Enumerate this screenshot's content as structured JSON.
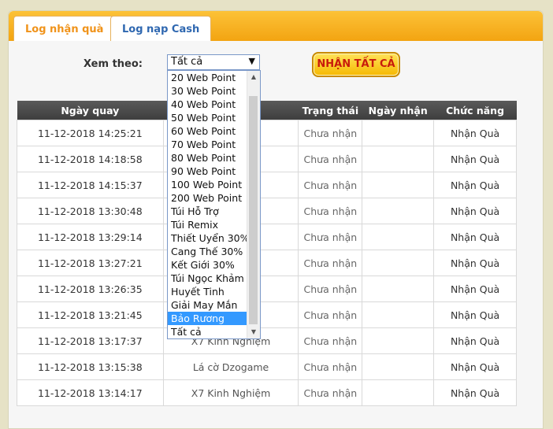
{
  "tabs": [
    {
      "label": "Log nhận quà",
      "active": true
    },
    {
      "label": "Log nạp Cash",
      "active": false
    }
  ],
  "filter": {
    "label": "Xem theo:",
    "selected_value": "Tất cả",
    "options": [
      "20 Web Point",
      "30 Web Point",
      "40 Web Point",
      "50 Web Point",
      "60 Web Point",
      "70 Web Point",
      "80 Web Point",
      "90 Web Point",
      "100 Web Point",
      "200 Web Point",
      "Túi Hỗ Trợ",
      "Túi Remix",
      "Thiết Uyển 30%",
      "Cang Thế 30%",
      "Kết Giới 30%",
      "Túi Ngọc Khảm",
      "Huyết Tinh",
      "Giải May Mắn",
      "Bảo Rương",
      "Tất cả"
    ],
    "highlighted_option": "Bảo Rương"
  },
  "claim_all_button": "NHẬN TẤT CẢ",
  "table": {
    "headers": [
      "Ngày quay",
      "",
      "Trạng thái",
      "Ngày nhận",
      "Chức năng"
    ],
    "rows": [
      {
        "date": "11-12-2018 14:25:21",
        "item": "",
        "status": "Chưa nhận",
        "received": "",
        "action": "Nhận Quà"
      },
      {
        "date": "11-12-2018 14:18:58",
        "item": "",
        "status": "Chưa nhận",
        "received": "",
        "action": "Nhận Quà"
      },
      {
        "date": "11-12-2018 14:15:37",
        "item": "",
        "status": "Chưa nhận",
        "received": "",
        "action": "Nhận Quà"
      },
      {
        "date": "11-12-2018 13:30:48",
        "item": "",
        "status": "Chưa nhận",
        "received": "",
        "action": "Nhận Quà"
      },
      {
        "date": "11-12-2018 13:29:14",
        "item": "",
        "status": "Chưa nhận",
        "received": "",
        "action": "Nhận Quà"
      },
      {
        "date": "11-12-2018 13:27:21",
        "item": "",
        "status": "Chưa nhận",
        "received": "",
        "action": "Nhận Quà"
      },
      {
        "date": "11-12-2018 13:26:35",
        "item": "",
        "status": "Chưa nhận",
        "received": "",
        "action": "Nhận Quà"
      },
      {
        "date": "11-12-2018 13:21:45",
        "item": "",
        "status": "Chưa nhận",
        "received": "",
        "action": "Nhận Quà"
      },
      {
        "date": "11-12-2018 13:17:37",
        "item": "X7 Kinh Nghiệm",
        "status": "Chưa nhận",
        "received": "",
        "action": "Nhận Quà"
      },
      {
        "date": "11-12-2018 13:15:38",
        "item": "Lá cờ Dzogame",
        "status": "Chưa nhận",
        "received": "",
        "action": "Nhận Quà"
      },
      {
        "date": "11-12-2018 13:14:17",
        "item": "X7 Kinh Nghiệm",
        "status": "Chưa nhận",
        "received": "",
        "action": "Nhận Quà"
      }
    ]
  },
  "icons": {
    "select_arrow": "triangle-down-icon"
  }
}
